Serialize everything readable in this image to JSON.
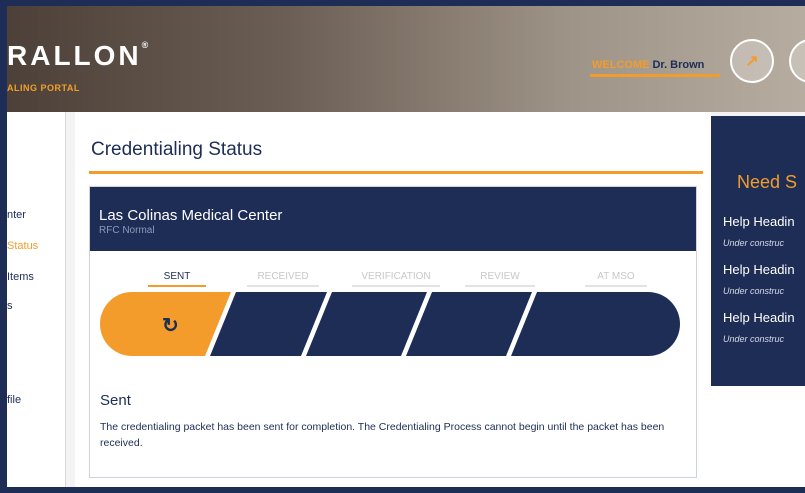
{
  "header": {
    "logo_text": "RALLON",
    "logo_mark": "®",
    "portal_text": "ALING PORTAL",
    "welcome_label": "WELCOME",
    "user_name": "Dr. Brown",
    "button_glyph": "↗"
  },
  "sidebar": {
    "items": [
      {
        "label": "nter"
      },
      {
        "label": "Status"
      },
      {
        "label": "Items"
      },
      {
        "label": "s"
      },
      {
        "label": "file"
      }
    ]
  },
  "main": {
    "title": "Credentialing Status",
    "facility": "Las Colinas Medical Center",
    "subtitle": "RFC Normal",
    "steps": [
      {
        "label": "SENT"
      },
      {
        "label": "RECEIVED"
      },
      {
        "label": "VERIFICATION"
      },
      {
        "label": "REVIEW"
      },
      {
        "label": "AT MSO"
      }
    ],
    "active_step_icon": "↻",
    "status_heading": "Sent",
    "status_description": "The credentialing packet has been sent for completion. The Credentialing Process cannot begin until the packet has been received."
  },
  "help": {
    "title": "Need S",
    "items": [
      {
        "heading": "Help Headin",
        "sub": "Under construc"
      },
      {
        "heading": "Help Headin",
        "sub": "Under construc"
      },
      {
        "heading": "Help Headin",
        "sub": "Under construc"
      }
    ]
  },
  "colors": {
    "navy": "#1d2d55",
    "orange": "#f39c2b"
  }
}
